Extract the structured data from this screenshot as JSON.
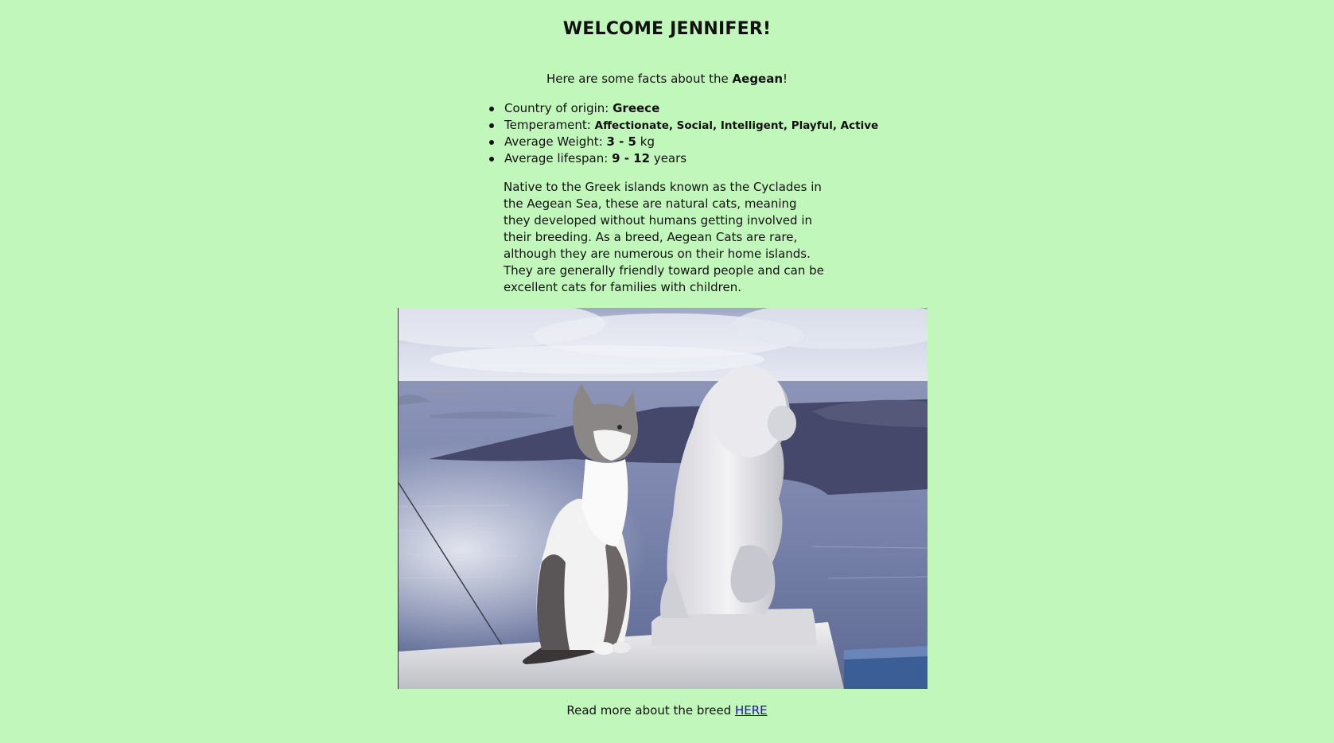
{
  "header": {
    "title": "WELCOME JENNIFER!"
  },
  "intro": {
    "prefix": "Here are some facts about the ",
    "breed": "Aegean",
    "suffix": "!"
  },
  "facts": {
    "origin_label": "Country of origin: ",
    "origin_value": "Greece",
    "temperament_label": "Temperament: ",
    "temperament_value": "Affectionate, Social, Intelligent, Playful, Active",
    "weight_label": "Average Weight: ",
    "weight_value": "3 - 5",
    "weight_unit": " kg",
    "lifespan_label": "Average lifespan: ",
    "lifespan_value": "9 - 12",
    "lifespan_unit": " years"
  },
  "description": "Native to the Greek islands known as the Cyclades in the Aegean Sea, these are natural cats, meaning they developed without humans getting involved in their breeding. As a breed, Aegean Cats are rare, although they are numerous on their home islands. They are generally friendly toward people and can be excellent cats for families with children.",
  "footer": {
    "prefix": "Read more about the breed ",
    "link_label": "HERE"
  },
  "colors": {
    "background": "#c2f7bb",
    "link": "#1a0dab",
    "text": "#111111"
  }
}
